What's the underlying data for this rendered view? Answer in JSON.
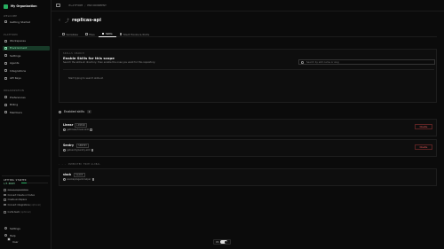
{
  "org": {
    "name": "My Organization"
  },
  "sidebar": {
    "welcome_label": "WELCOME",
    "getting_started": "Getting Started",
    "platform_label": "PLATFORM",
    "platform_items": [
      {
        "label": "Workspaces",
        "icon": "grid-icon"
      },
      {
        "label": "Environment",
        "icon": "box-icon",
        "active": true
      },
      {
        "label": "Settings",
        "icon": "gear-icon"
      },
      {
        "label": "Agents",
        "icon": "bot-icon"
      },
      {
        "label": "Integrations",
        "icon": "plug-icon"
      },
      {
        "label": "API Keys",
        "icon": "key-icon"
      }
    ],
    "organization_label": "ORGANIZATION",
    "org_items": [
      {
        "label": "Preferences",
        "icon": "sliders-icon"
      },
      {
        "label": "Billing",
        "icon": "card-icon"
      },
      {
        "label": "Members",
        "icon": "users-icon"
      }
    ],
    "getting_started_box": {
      "title": "GETTING STARTED",
      "progress_text": "1/5 READY",
      "progress": 0.2,
      "steps": [
        {
          "label": "Set up organization",
          "done": true,
          "note": ""
        },
        {
          "label": "Connect Claude or Codex",
          "done": false,
          "note": ""
        },
        {
          "label": "Create workspace",
          "done": false,
          "note": ""
        },
        {
          "label": "Connect integrations",
          "done": false,
          "note": "(optional)"
        },
        {
          "label": "Invite team",
          "done": false,
          "note": "(optional)"
        }
      ]
    },
    "bottom": {
      "settings": "Settings",
      "help": "Help",
      "user": "User"
    }
  },
  "topbar": {
    "crumbs": [
      "PLATFORM",
      "ENVIRONMENT"
    ]
  },
  "page": {
    "back_glyph": "‹",
    "title": "replicas-api",
    "title_icon": "⤴"
  },
  "tabs": [
    {
      "label": "Variables",
      "active": false
    },
    {
      "label": "Files",
      "active": false
    },
    {
      "label": "Skills",
      "active": true
    },
    {
      "label": "Start Hooks & Ports",
      "active": false
    }
  ],
  "skills_search": {
    "caps_label": "SKILLS SEARCH",
    "title": "Enable Skills for this scope",
    "description": "Search the skills.sh directory, then enable the ones you want for this repository.",
    "placeholder": "Search by skill name or slug",
    "empty_text": "Start typing to search skills.sh"
  },
  "enabled": {
    "title": "Enabled skills",
    "count": "2",
    "skills": [
      {
        "name": "Linear",
        "tag": "LINEAR",
        "repo": "getlinear/linear-skill",
        "action": "Disable"
      },
      {
        "name": "Sentry",
        "tag": "SENTRY",
        "repo": "getsentry/sentry-skill",
        "action": "Disable"
      }
    ]
  },
  "inherited": {
    "label": "INHERITED FROM GLOBAL",
    "skills": [
      {
        "name": "slack",
        "tag": "SLACK",
        "repo": "slackapi/agent-helper"
      }
    ]
  },
  "footer_toggle": {
    "label": "OS"
  }
}
